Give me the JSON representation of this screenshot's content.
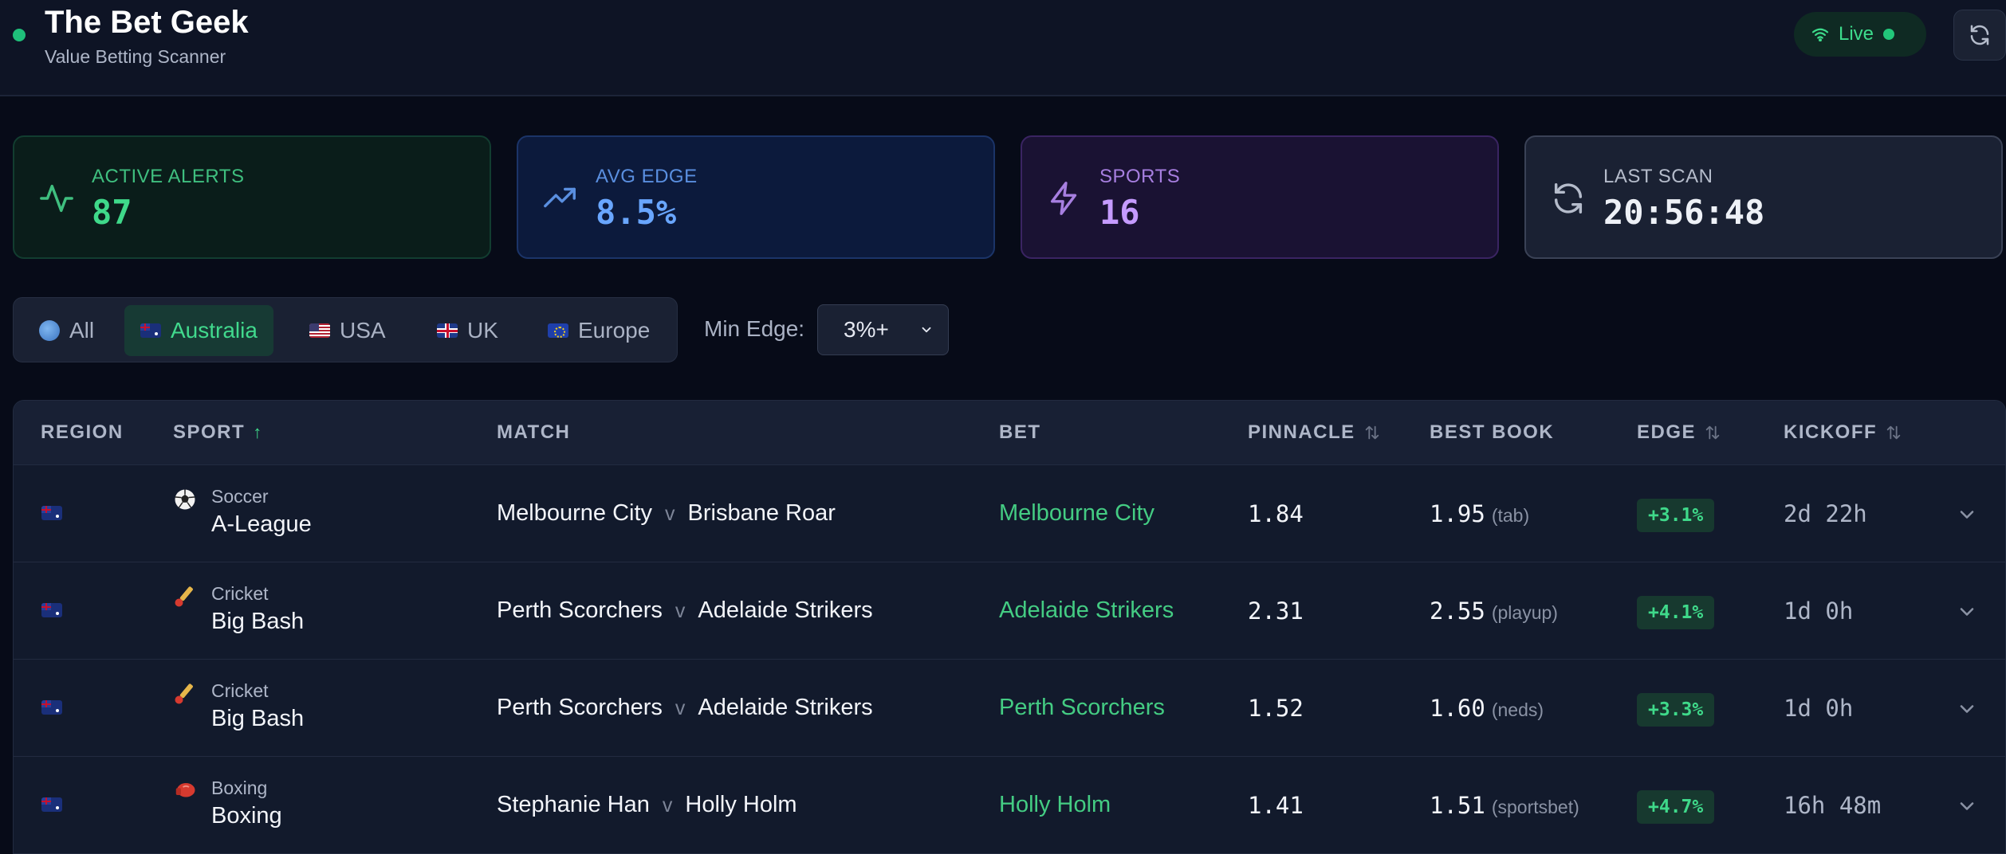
{
  "header": {
    "title": "The Bet Geek",
    "subtitle": "Value Betting Scanner",
    "live_label": "Live"
  },
  "stats": [
    {
      "label": "ACTIVE ALERTS",
      "value": "87",
      "icon": "activity-icon"
    },
    {
      "label": "AVG EDGE",
      "value": "8.5%",
      "icon": "trending-up-icon"
    },
    {
      "label": "SPORTS",
      "value": "16",
      "icon": "lightning-icon"
    },
    {
      "label": "LAST SCAN",
      "value": "20:56:48",
      "icon": "refresh-icon"
    }
  ],
  "regions": [
    {
      "label": "All",
      "icon": "globe-icon"
    },
    {
      "label": "Australia",
      "icon": "flag-au-icon",
      "active": true
    },
    {
      "label": "USA",
      "icon": "flag-us-icon"
    },
    {
      "label": "UK",
      "icon": "flag-uk-icon"
    },
    {
      "label": "Europe",
      "icon": "flag-eu-icon"
    }
  ],
  "filter": {
    "min_edge_label": "Min Edge:",
    "min_edge_value": "3%+"
  },
  "table": {
    "columns": [
      "REGION",
      "SPORT",
      "MATCH",
      "BET",
      "PINNACLE",
      "BEST BOOK",
      "EDGE",
      "KICKOFF"
    ],
    "rows": [
      {
        "region": "flag-au-icon",
        "sport_icon": "soccer-ball-icon",
        "category": "Soccer",
        "league": "A-League",
        "home": "Melbourne City",
        "vs": "v",
        "away": "Brisbane Roar",
        "bet": "Melbourne City",
        "pinnacle": "1.84",
        "best_odds": "1.95",
        "book": "(tab)",
        "edge": "+3.1%",
        "kickoff": "2d 22h"
      },
      {
        "region": "flag-au-icon",
        "sport_icon": "cricket-icon",
        "category": "Cricket",
        "league": "Big Bash",
        "home": "Perth Scorchers",
        "vs": "v",
        "away": "Adelaide Strikers",
        "bet": "Adelaide Strikers",
        "pinnacle": "2.31",
        "best_odds": "2.55",
        "book": "(playup)",
        "edge": "+4.1%",
        "kickoff": "1d 0h"
      },
      {
        "region": "flag-au-icon",
        "sport_icon": "cricket-icon",
        "category": "Cricket",
        "league": "Big Bash",
        "home": "Perth Scorchers",
        "vs": "v",
        "away": "Adelaide Strikers",
        "bet": "Perth Scorchers",
        "pinnacle": "1.52",
        "best_odds": "1.60",
        "book": "(neds)",
        "edge": "+3.3%",
        "kickoff": "1d 0h"
      },
      {
        "region": "flag-au-icon",
        "sport_icon": "boxing-glove-icon",
        "category": "Boxing",
        "league": "Boxing",
        "home": "Stephanie Han",
        "vs": "v",
        "away": "Holly Holm",
        "bet": "Holly Holm",
        "pinnacle": "1.41",
        "best_odds": "1.51",
        "book": "(sportsbet)",
        "edge": "+4.7%",
        "kickoff": "16h 48m"
      }
    ]
  },
  "colors": {
    "background": "#070b18",
    "accent_green": "#3fd98a",
    "accent_blue": "#69a6ff",
    "accent_purple": "#c59bff"
  }
}
